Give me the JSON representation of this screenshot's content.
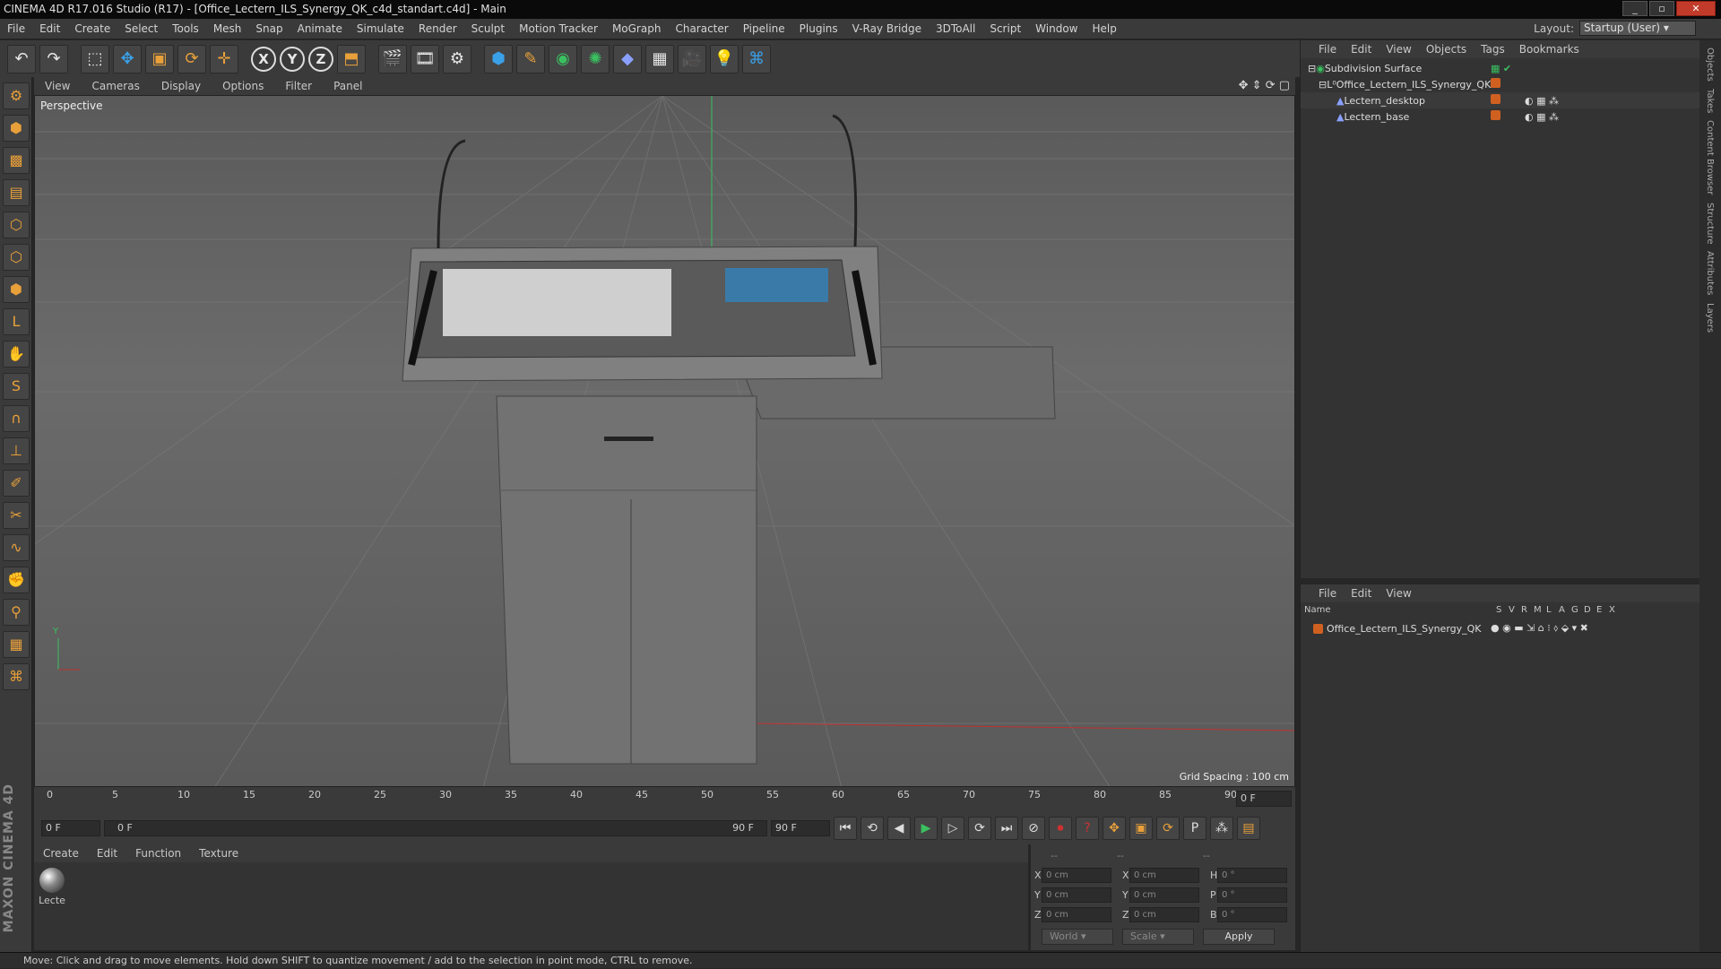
{
  "window": {
    "title": "CINEMA 4D R17.016 Studio (R17) - [Office_Lectern_ILS_Synergy_QK_c4d_standart.c4d] - Main"
  },
  "menu": [
    "File",
    "Edit",
    "Create",
    "Select",
    "Tools",
    "Mesh",
    "Snap",
    "Animate",
    "Simulate",
    "Render",
    "Sculpt",
    "Motion Tracker",
    "MoGraph",
    "Character",
    "Pipeline",
    "Plugins",
    "V-Ray Bridge",
    "3DToAll",
    "Script",
    "Window",
    "Help"
  ],
  "layout": {
    "label": "Layout:",
    "value": "Startup (User)"
  },
  "viewport": {
    "menu": [
      "View",
      "Cameras",
      "Display",
      "Options",
      "Filter",
      "Panel"
    ],
    "name": "Perspective",
    "grid_spacing": "Grid Spacing : 100 cm"
  },
  "timeline": {
    "ticks": [
      "0",
      "5",
      "10",
      "15",
      "20",
      "25",
      "30",
      "35",
      "40",
      "45",
      "50",
      "55",
      "60",
      "65",
      "70",
      "75",
      "80",
      "85",
      "90"
    ],
    "current": "0 F",
    "start": "0 F",
    "range_start": "0 F",
    "range_end": "90 F",
    "end": "90 F"
  },
  "materials": {
    "menu": [
      "Create",
      "Edit",
      "Function",
      "Texture"
    ],
    "items": [
      "Lecte"
    ]
  },
  "coords": {
    "headers": [
      "--",
      "--",
      "--"
    ],
    "rows": [
      {
        "a": "X",
        "av": "0 cm",
        "b": "X",
        "bv": "0 cm",
        "c": "H",
        "cv": "0 °"
      },
      {
        "a": "Y",
        "av": "0 cm",
        "b": "Y",
        "bv": "0 cm",
        "c": "P",
        "cv": "0 °"
      },
      {
        "a": "Z",
        "av": "0 cm",
        "b": "Z",
        "bv": "0 cm",
        "c": "B",
        "cv": "0 °"
      }
    ],
    "world": "World",
    "scale": "Scale",
    "apply": "Apply"
  },
  "objects": {
    "menu": [
      "File",
      "Edit",
      "View",
      "Objects",
      "Tags",
      "Bookmarks"
    ],
    "tree": [
      "Subdivision Surface",
      "Office_Lectern_ILS_Synergy_QK",
      "Lectern_desktop",
      "Lectern_base"
    ]
  },
  "layers": {
    "menu": [
      "File",
      "Edit",
      "View"
    ],
    "columns": [
      "Name",
      "S",
      "V",
      "R",
      "M",
      "L",
      "A",
      "G",
      "D",
      "E",
      "X"
    ],
    "rows": [
      "Office_Lectern_ILS_Synergy_QK"
    ]
  },
  "side_tabs": [
    "Objects",
    "Takes",
    "Content Browser",
    "Structure",
    "Attributes",
    "Layers"
  ],
  "status": "Move: Click and drag to move elements. Hold down SHIFT to quantize movement / add to the selection in point mode, CTRL to remove."
}
